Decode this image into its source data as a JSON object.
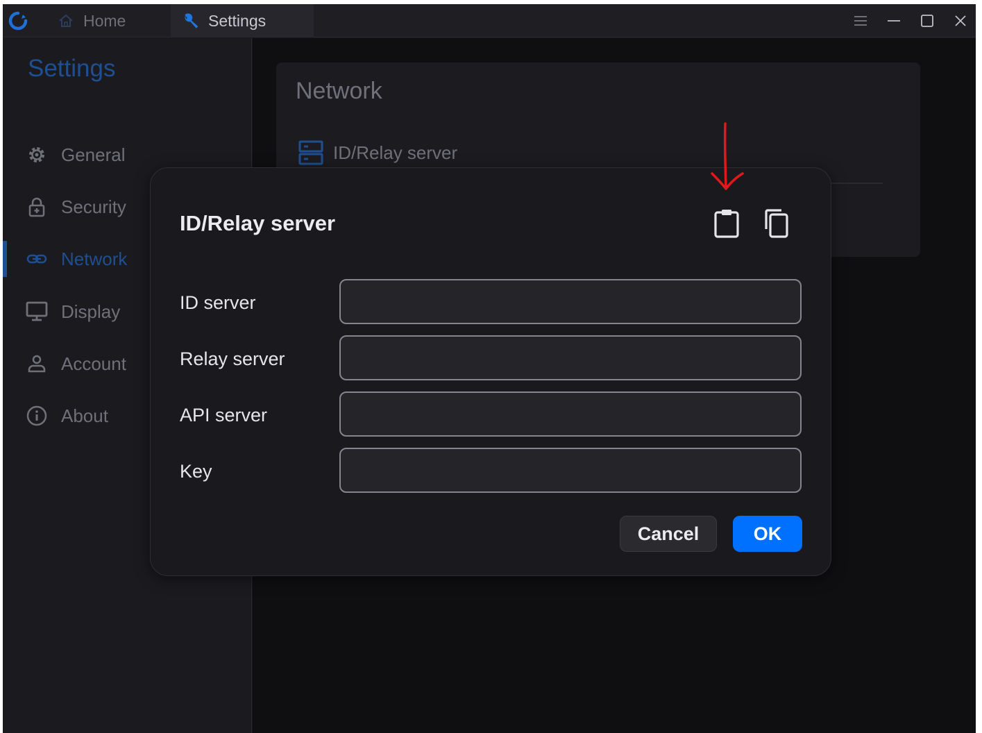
{
  "titlebar": {
    "tabs": [
      {
        "label": "Home",
        "icon": "home-icon"
      },
      {
        "label": "Settings",
        "icon": "wrench-icon"
      }
    ],
    "controls": [
      "menu-icon",
      "minimize-icon",
      "maximize-icon",
      "close-icon"
    ],
    "logo": "app-logo"
  },
  "sidebar": {
    "title": "Settings",
    "items": [
      {
        "label": "General",
        "icon": "gear-icon"
      },
      {
        "label": "Security",
        "icon": "lock-icon"
      },
      {
        "label": "Network",
        "icon": "link-icon",
        "active": true
      },
      {
        "label": "Display",
        "icon": "monitor-icon"
      },
      {
        "label": "Account",
        "icon": "user-icon"
      },
      {
        "label": "About",
        "icon": "info-icon"
      }
    ]
  },
  "panel": {
    "title": "Network",
    "item_label": "ID/Relay server",
    "item_icon": "server-icon"
  },
  "dialog": {
    "title": "ID/Relay server",
    "paste_icon": "clipboard-icon",
    "copy_icon": "copy-icon",
    "fields": [
      {
        "label": "ID server",
        "value": ""
      },
      {
        "label": "Relay server",
        "value": ""
      },
      {
        "label": "API server",
        "value": ""
      },
      {
        "label": "Key",
        "value": ""
      }
    ],
    "cancel_label": "Cancel",
    "ok_label": "OK"
  },
  "annotation": {
    "type": "red-arrow",
    "color": "#e0191c",
    "points_to": "clipboard-icon"
  },
  "colors": {
    "accent": "#0071ff",
    "active_nav": "#1e4f92",
    "background": "#18181c",
    "dialog_bg": "#1a1a1e"
  }
}
